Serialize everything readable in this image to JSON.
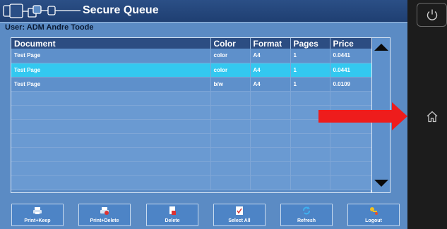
{
  "header": {
    "title": "Secure Queue"
  },
  "user": {
    "line": "User: ADM Andre Toode"
  },
  "table": {
    "columns": [
      "Document",
      "Color",
      "Format",
      "Pages",
      "Price"
    ],
    "rows": [
      [
        "Test Page",
        "color",
        "A4",
        "1",
        "0.0441"
      ],
      [
        "Test Page",
        "color",
        "A4",
        "1",
        "0.0441"
      ],
      [
        "Test Page",
        "b/w",
        "A4",
        "1",
        "0.0109"
      ]
    ],
    "selected_row": 2
  },
  "actions": {
    "print_keep": "Print+Keep",
    "print_delete": "Print+Delete",
    "delete": "Delete",
    "select_all": "Select All",
    "refresh": "Refresh",
    "logout": "Logout"
  },
  "icons": {
    "power": "power-icon",
    "home": "home-icon",
    "scroll_up": "triangle-up-icon",
    "scroll_down": "triangle-down-icon"
  },
  "colors": {
    "accent": "#33c8f0",
    "title_bar": "#2b4f86",
    "panel": "#5b8bc4",
    "arrow": "#ee1c1c"
  }
}
